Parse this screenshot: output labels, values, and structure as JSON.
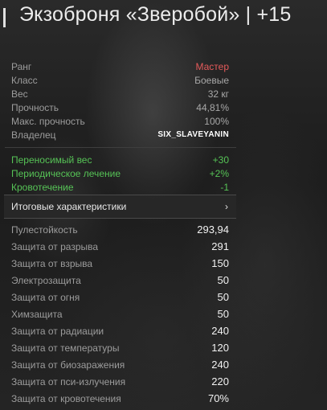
{
  "title": "Экзоброня «Зверобой» | +15",
  "info": [
    {
      "label": "Ранг",
      "value": "Мастер",
      "style": "red"
    },
    {
      "label": "Класс",
      "value": "Боевые",
      "style": ""
    },
    {
      "label": "Вес",
      "value": "32 кг",
      "style": ""
    },
    {
      "label": "Прочность",
      "value": "44,81%",
      "style": ""
    },
    {
      "label": "Макс. прочность",
      "value": "100%",
      "style": ""
    },
    {
      "label": "Владелец",
      "value": "SIX_SLAVEYANIN",
      "style": "white"
    }
  ],
  "bonuses": [
    {
      "label": "Переносимый вес",
      "value": "+30"
    },
    {
      "label": "Периодическое лечение",
      "value": "+2%"
    },
    {
      "label": "Кровотечение",
      "value": "-1"
    }
  ],
  "section": {
    "label": "Итоговые характеристики",
    "chevron": "›"
  },
  "stats": [
    {
      "label": "Пулестойкость",
      "value": "293,94"
    },
    {
      "label": "Защита от разрыва",
      "value": "291"
    },
    {
      "label": "Защита от взрыва",
      "value": "150"
    },
    {
      "label": "Электрозащита",
      "value": "50"
    },
    {
      "label": "Защита от огня",
      "value": "50"
    },
    {
      "label": "Химзащита",
      "value": "50"
    },
    {
      "label": "Защита от радиации",
      "value": "240"
    },
    {
      "label": "Защита от температуры",
      "value": "120"
    },
    {
      "label": "Защита от биозаражения",
      "value": "240"
    },
    {
      "label": "Защита от пси-излучения",
      "value": "220"
    },
    {
      "label": "Защита от кровотечения",
      "value": "70%"
    }
  ],
  "colors": {
    "rank": "#e55a5a",
    "bonus": "#56c356"
  }
}
